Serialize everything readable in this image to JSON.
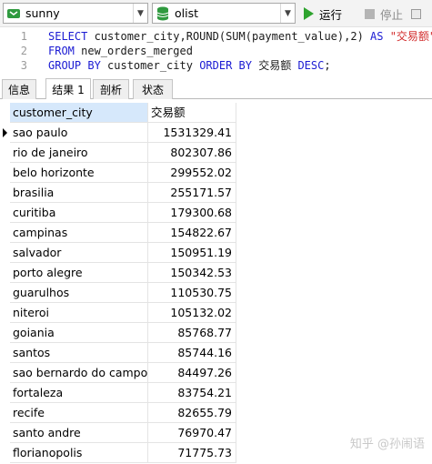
{
  "toolbar": {
    "connection": "sunny",
    "database": "olist",
    "run_label": "运行",
    "stop_label": "停止"
  },
  "editor": {
    "lines": [
      {
        "no": "1",
        "parts": [
          {
            "t": "SELECT ",
            "c": "kw"
          },
          {
            "t": "customer_city,ROUND(SUM(payment_value),2) ",
            "c": "plain"
          },
          {
            "t": "AS ",
            "c": "kw"
          },
          {
            "t": "\"交易额\"",
            "c": "str"
          }
        ]
      },
      {
        "no": "2",
        "parts": [
          {
            "t": "FROM ",
            "c": "kw"
          },
          {
            "t": "new_orders_merged",
            "c": "plain"
          }
        ]
      },
      {
        "no": "3",
        "parts": [
          {
            "t": "GROUP BY ",
            "c": "kw"
          },
          {
            "t": "customer_city ",
            "c": "plain"
          },
          {
            "t": "ORDER BY ",
            "c": "kw"
          },
          {
            "t": "交易额 ",
            "c": "plain"
          },
          {
            "t": "DESC",
            "c": "kw"
          },
          {
            "t": ";",
            "c": "plain"
          }
        ]
      }
    ]
  },
  "tabs": [
    "信息",
    "结果 1",
    "剖析",
    "状态"
  ],
  "active_tab": "结果 1",
  "result": {
    "columns": [
      "customer_city",
      "交易额"
    ],
    "rows": [
      [
        "sao paulo",
        "1531329.41"
      ],
      [
        "rio de janeiro",
        "802307.86"
      ],
      [
        "belo horizonte",
        "299552.02"
      ],
      [
        "brasilia",
        "255171.57"
      ],
      [
        "curitiba",
        "179300.68"
      ],
      [
        "campinas",
        "154822.67"
      ],
      [
        "salvador",
        "150951.19"
      ],
      [
        "porto alegre",
        "150342.53"
      ],
      [
        "guarulhos",
        "110530.75"
      ],
      [
        "niteroi",
        "105132.02"
      ],
      [
        "goiania",
        "85768.77"
      ],
      [
        "santos",
        "85744.16"
      ],
      [
        "sao bernardo do campo",
        "84497.26"
      ],
      [
        "fortaleza",
        "83754.21"
      ],
      [
        "recife",
        "82655.79"
      ],
      [
        "santo andre",
        "76970.47"
      ],
      [
        "florianopolis",
        "71775.73"
      ]
    ]
  },
  "watermark": "知乎 @孙闹语"
}
